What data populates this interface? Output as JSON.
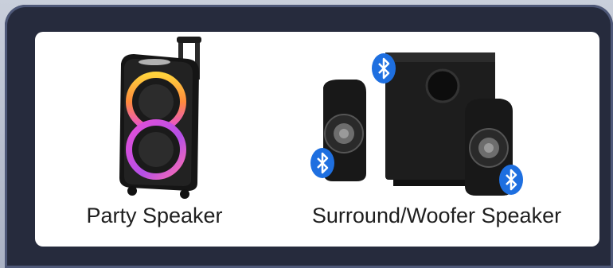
{
  "products": [
    {
      "label": "Party Speaker",
      "image_icon": "party-speaker-image"
    },
    {
      "label": "Surround/Woofer Speaker",
      "image_icon": "surround-woofer-speaker-image",
      "badge_icon": "bluetooth-icon"
    }
  ],
  "colors": {
    "frame": "#262b3d",
    "card": "#ffffff",
    "bluetooth": "#1e6fe0",
    "ring_magenta": "#e64fd8",
    "ring_yellow": "#ffd23c"
  }
}
